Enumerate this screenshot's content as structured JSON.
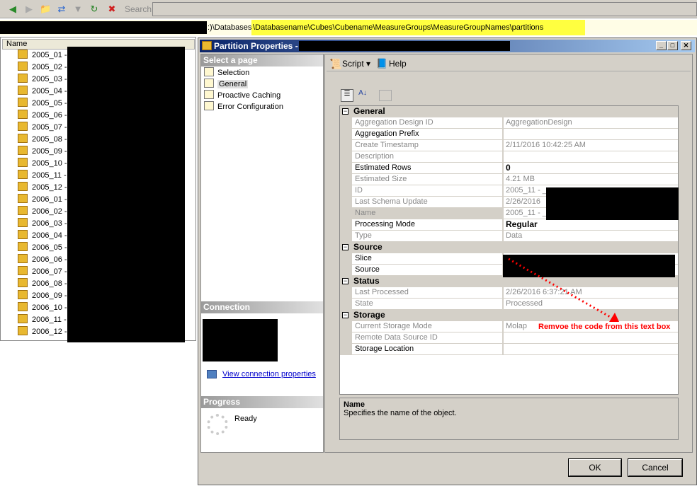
{
  "toolbar": {
    "icons": [
      "back-icon",
      "forward-icon",
      "folder-up-icon",
      "sync-icon",
      "filter-icon",
      "refresh-icon",
      "delete-script-icon"
    ],
    "search_label": "Search"
  },
  "address": {
    "path_plain": ":)\\Databases",
    "path_highlight": "\\Databasename\\Cubes\\Cubename\\MeasureGroups\\MeasureGroupNames\\partitions",
    "highlight_color": "#ffff40"
  },
  "list": {
    "column": "Name",
    "items": [
      "2005_01 -",
      "2005_02 -",
      "2005_03 -",
      "2005_04 -",
      "2005_05 -",
      "2005_06 -",
      "2005_07 -",
      "2005_08 -",
      "2005_09 -",
      "2005_10 -",
      "2005_11 -",
      "2005_12 -",
      "2006_01 -",
      "2006_02 -",
      "2006_03 -",
      "2006_04 -",
      "2006_05 -",
      "2006_06 -",
      "2006_07 -",
      "2006_08 -",
      "2006_09 -",
      "2006_10 -",
      "2006_11 -",
      "2006_12 -"
    ]
  },
  "dialog": {
    "title": "Partition Properties -",
    "select_page": "Select a page",
    "pages": [
      "Selection",
      "General",
      "Proactive Caching",
      "Error Configuration"
    ],
    "selected_page": "General",
    "connection_header": "Connection",
    "connection_link": "View connection properties",
    "progress_header": "Progress",
    "progress_status": "Ready",
    "script": "Script",
    "help": "Help",
    "grid": [
      {
        "category": "General",
        "rows": [
          {
            "name": "Aggregation Design ID",
            "value": "AggregationDesign",
            "ro": true
          },
          {
            "name": "Aggregation Prefix",
            "value": "",
            "ro": false
          },
          {
            "name": "Create Timestamp",
            "value": "2/11/2016 10:42:25 AM",
            "ro": true
          },
          {
            "name": "Description",
            "value": "",
            "ro": true
          },
          {
            "name": "Estimated Rows",
            "value": "0",
            "ro": false,
            "bold": true
          },
          {
            "name": "Estimated Size",
            "value": "4.21 MB",
            "ro": true
          },
          {
            "name": "ID",
            "value": "2005_11 - _",
            "ro": true
          },
          {
            "name": "Last Schema Update",
            "value": "2/26/2016",
            "ro": true
          },
          {
            "name": "Name",
            "value": "2005_11 - _",
            "ro": true,
            "selected": true
          },
          {
            "name": "Processing Mode",
            "value": "Regular",
            "ro": false,
            "bold": true
          },
          {
            "name": "Type",
            "value": "Data",
            "ro": true
          }
        ]
      },
      {
        "category": "Source",
        "rows": [
          {
            "name": "Slice",
            "value": "",
            "ro": false
          },
          {
            "name": "Source",
            "value": "",
            "ro": false
          }
        ]
      },
      {
        "category": "Status",
        "rows": [
          {
            "name": "Last Processed",
            "value": "2/26/2016 6:37:21 AM",
            "ro": true
          },
          {
            "name": "State",
            "value": "Processed",
            "ro": true
          }
        ]
      },
      {
        "category": "Storage",
        "rows": [
          {
            "name": "Current Storage Mode",
            "value": "Molap",
            "ro": true
          },
          {
            "name": "Remote Data Source ID",
            "value": "",
            "ro": true
          },
          {
            "name": "Storage Location",
            "value": "",
            "ro": false
          }
        ]
      }
    ],
    "desc_title": "Name",
    "desc_text": "Specifies the name of the object.",
    "ok": "OK",
    "cancel": "Cancel"
  },
  "annotation": {
    "text": "Remvoe the code from this text box",
    "color": "#ff0000"
  }
}
